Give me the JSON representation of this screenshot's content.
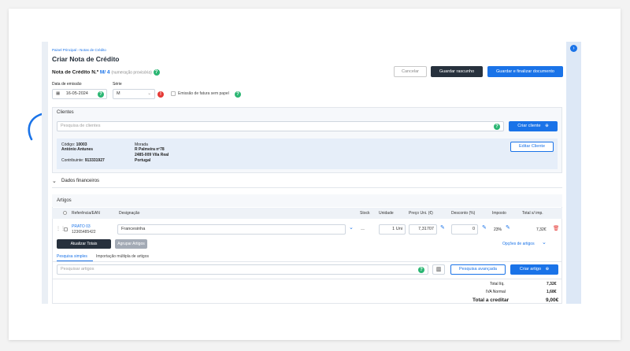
{
  "breadcrumb": {
    "home": "Painel Principal",
    "separator": "›",
    "current": "Notas de Crédito"
  },
  "page": {
    "title": "Criar Nota de Crédito"
  },
  "doc": {
    "number_label": "Nota de Crédito N.º",
    "series_number": "M/ 4",
    "note": "(numeração provisória)"
  },
  "actions": {
    "cancel": "Cancelar",
    "save_draft": "Guardar rascunho",
    "save_finalize": "Guardar e finalizar documento"
  },
  "fields": {
    "date_label": "Data de emissão",
    "date_value": "16-05-2024",
    "series_label": "Série",
    "series_value": "M",
    "paperless_label": "Emissão de fatura sem papel"
  },
  "clients": {
    "title": "Clientes",
    "search_placeholder": "Pesquisa de clientes",
    "create_button": "Criar cliente",
    "code_label": "Código:",
    "code_value": "10003",
    "name": "António Antunes",
    "taxid_label": "Contribuinte:",
    "taxid_value": "913331927",
    "address_label": "Morada",
    "address_line1": "R Palmeira nº78",
    "address_line2": "2485-009 Vila Real",
    "address_line3": "Portugal",
    "edit_button": "Editar Cliente"
  },
  "financial": {
    "title": "Dados financeiros"
  },
  "articles": {
    "title": "Artigos",
    "columns": [
      "Referência/EAN",
      "Designação",
      "Stock",
      "Unidade",
      "Preço Uni. (€)",
      "Desconto (%)",
      "Imposto",
      "Total s/ imp."
    ],
    "row": {
      "ref": "PRATO 03",
      "ean": "12365485422",
      "designation": "Francesinha",
      "stock": "—",
      "unit": "1 Uni",
      "price": "7,31707",
      "discount": "0",
      "tax": "23%",
      "total": "7,32€"
    },
    "update_totals": "Atualizar Totais",
    "group_articles": "Agrupar Artigos",
    "options": "Opções de artigos",
    "tab_simple": "Pesquisa simples",
    "tab_multiple": "Importação múltipla de artigos",
    "search_placeholder": "Pesquisar artigos",
    "advanced_search": "Pesquisa avançada",
    "create_article": "Criar artigo"
  },
  "totals": {
    "liquid_label": "Total líq.",
    "liquid_value": "7,32€",
    "vat_label": "IVA Normal",
    "vat_value": "1,68€",
    "credit_label": "Total a creditar",
    "credit_value": "9,00€"
  },
  "icons": {
    "help": "?",
    "warning": "!",
    "collapse": "›",
    "add": "⊕"
  },
  "colors": {
    "accent": "#1a73e8",
    "dark_button": "#27313d",
    "success": "#2bb673",
    "danger": "#e53935"
  }
}
